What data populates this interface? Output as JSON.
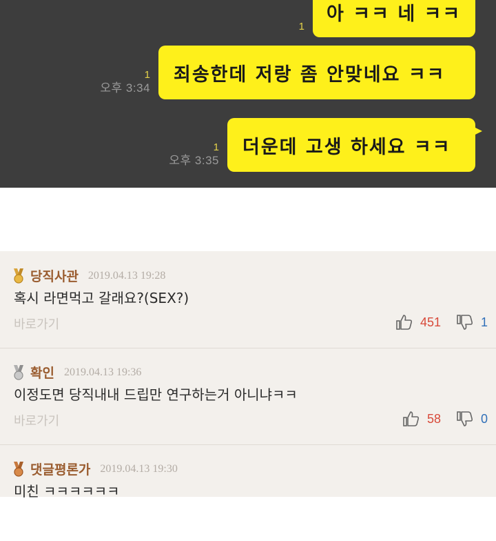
{
  "chat": {
    "messages": [
      {
        "text": "아 ㅋㅋ 네 ㅋㅋ",
        "unread": "1",
        "time": ""
      },
      {
        "text": "죄송한데 저랑 좀 안맞네요 ㅋㅋ",
        "unread": "1",
        "time": "오후 3:34"
      },
      {
        "text": "더운데 고생 하세요 ㅋㅋ",
        "unread": "1",
        "time": "오후 3:35"
      }
    ],
    "colors": {
      "background": "#3d3d3d",
      "bubble": "#fef01b",
      "unread": "#e4d24a"
    }
  },
  "comments": [
    {
      "medal": "gold-medal-icon",
      "nickname": "당직사관",
      "date": "2019.04.13 19:28",
      "text": "혹시 라면먹고 갈래요?(SEX?)",
      "link": "바로가기",
      "likes": "451",
      "dislikes": "1"
    },
    {
      "medal": "silver-medal-icon",
      "nickname": "확인",
      "date": "2019.04.13 19:36",
      "text": "이정도면 당직내내 드립만 연구하는거 아니냐ㅋㅋ",
      "link": "바로가기",
      "likes": "58",
      "dislikes": "0"
    },
    {
      "medal": "bronze-medal-icon",
      "nickname": "댓글평론가",
      "date": "2019.04.13 19:30",
      "text": "미친 ㅋㅋㅋㅋㅋㅋ"
    }
  ],
  "colors": {
    "nickname": "#9a5c2f",
    "like": "#d84a3a",
    "dislike": "#2f6fb8",
    "comments_bg": "#f3f0ec"
  }
}
